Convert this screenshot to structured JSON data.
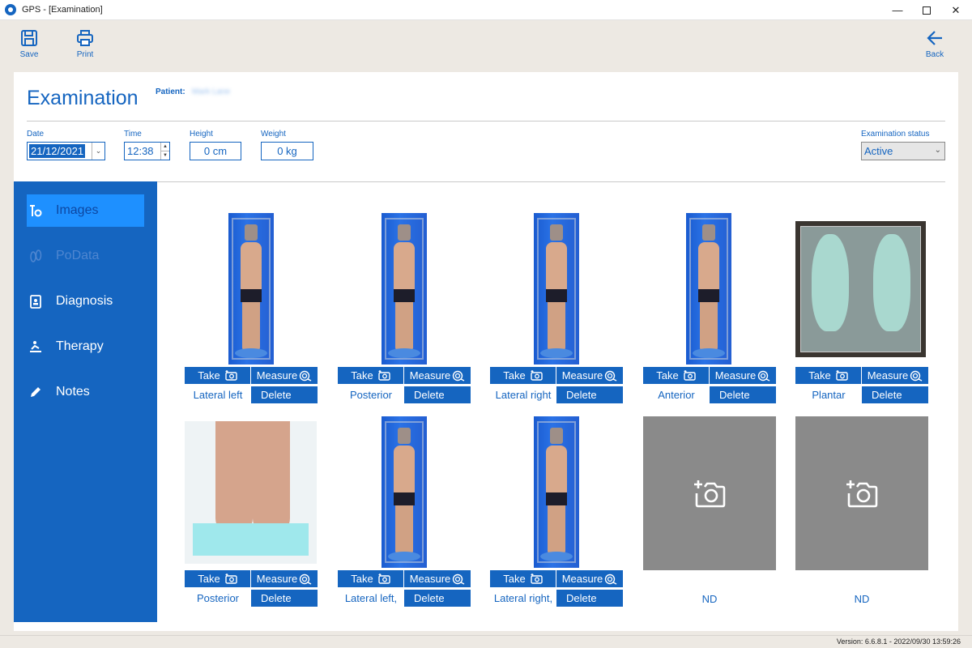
{
  "window": {
    "title": "GPS - [Examination]"
  },
  "toolbar": {
    "save_label": "Save",
    "print_label": "Print",
    "back_label": "Back"
  },
  "header": {
    "title": "Examination",
    "patient_label": "Patient:",
    "patient_value": "Mark Lane"
  },
  "fields": {
    "date_label": "Date",
    "date_value": "21/12/2021",
    "time_label": "Time",
    "time_value": "12:38",
    "height_label": "Height",
    "height_value": "0 cm",
    "weight_label": "Weight",
    "weight_value": "0 kg",
    "status_label": "Examination status",
    "status_value": "Active"
  },
  "sidebar": {
    "items": [
      {
        "label": "Images",
        "icon": "posture-icon",
        "state": "active"
      },
      {
        "label": "PoData",
        "icon": "footprint-icon",
        "state": "disabled"
      },
      {
        "label": "Diagnosis",
        "icon": "clipboard-icon",
        "state": "normal"
      },
      {
        "label": "Therapy",
        "icon": "therapy-icon",
        "state": "normal"
      },
      {
        "label": "Notes",
        "icon": "pencil-icon",
        "state": "normal"
      }
    ]
  },
  "buttons": {
    "take_label": "Take",
    "measure_label": "Measure",
    "delete_label": "Delete"
  },
  "images": [
    {
      "label": "Lateral left"
    },
    {
      "label": "Posterior"
    },
    {
      "label": "Lateral right"
    },
    {
      "label": "Anterior"
    },
    {
      "label": "Plantar"
    },
    {
      "label": "Posterior"
    },
    {
      "label": "Lateral left,"
    },
    {
      "label": "Lateral right,"
    },
    {
      "label": "ND"
    },
    {
      "label": "ND"
    }
  ],
  "statusbar": {
    "version": "Version: 6.6.8.1 - 2022/09/30 13:59:26"
  },
  "colors": {
    "accent": "#1565c0",
    "active": "#1e90ff",
    "empty": "#8a8a8a"
  }
}
